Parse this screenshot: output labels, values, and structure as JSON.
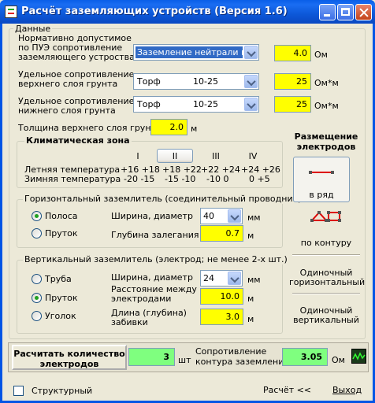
{
  "window": {
    "title": "Расчёт заземляющих устройств (Версия 1.6)"
  },
  "data_group": {
    "title": "Данные",
    "norm_label_1": "Нормативно допустимое",
    "norm_label_2": "по ПУЭ сопротивление",
    "norm_label_3": "заземляющего устроства",
    "norm_select": "Заземление нейтрали гене",
    "norm_value": "4.0",
    "norm_unit": "Ом",
    "upper_label_1": "Удельное сопротивление",
    "upper_label_2": "верхнего слоя грунта",
    "upper_select_name": "Торф",
    "upper_select_range": "10-25",
    "upper_value": "25",
    "upper_unit": "Ом*м",
    "lower_label_1": "Удельное сопротивление",
    "lower_label_2": "нижнего слоя грунта",
    "lower_select_name": "Торф",
    "lower_select_range": "10-25",
    "lower_value": "25",
    "lower_unit": "Ом*м",
    "thickness_label": "Толщина верхнего слоя грунта",
    "thickness_value": "2.0",
    "thickness_unit": "м"
  },
  "climate": {
    "title": "Климатическая зона",
    "zones": [
      "I",
      "II",
      "III",
      "IV"
    ],
    "summer_label": "Летняя температура",
    "winter_label": "Зимняя температура",
    "summer": [
      "+16 +18",
      "+18 +22",
      "+22 +24",
      "+24 +26"
    ],
    "winter": [
      "-20 -15",
      "-15 -10",
      "-10  0",
      "0 +5"
    ]
  },
  "horizontal": {
    "title": "Горизонтальный заземлитель (соединительный проводник)",
    "radio_1": "Полоса",
    "radio_2": "Пруток",
    "width_label": "Ширина, диаметр",
    "width_value": "40",
    "width_unit": "мм",
    "depth_label": "Глубина залегания",
    "depth_value": "0.7",
    "depth_unit": "м"
  },
  "vertical": {
    "title": "Вертикальный заземлитель (электрод; не менее 2-х шт.)",
    "radio_1": "Труба",
    "radio_2": "Пруток",
    "radio_3": "Уголок",
    "width_label": "Ширина, диаметр",
    "width_value": "24",
    "width_unit": "мм",
    "dist_label_1": "Расстояние между",
    "dist_label_2": "электродами",
    "dist_value": "10.0",
    "dist_unit": "м",
    "len_label_1": "Длина (глубина)",
    "len_label_2": "забивки",
    "len_value": "3.0",
    "len_unit": "м"
  },
  "placement": {
    "title_1": "Размещение",
    "title_2": "электродов",
    "row_label": "в ряд",
    "contour_label": "по контуру",
    "single_h_1": "Одиночный",
    "single_h_2": "горизонтальный",
    "single_v_1": "Одиночный",
    "single_v_2": "вертикальный"
  },
  "result": {
    "calc_label_1": "Расчитать количество",
    "calc_label_2": "электродов",
    "count_value": "3",
    "count_unit": "шт",
    "resist_label_1": "Сопротивление",
    "resist_label_2": "контура заземления",
    "resist_value": "3.05",
    "resist_unit": "Ом"
  },
  "footer": {
    "structural_label": "Структурный",
    "calc_link": "Расчёт <<",
    "exit_link": "Выход"
  }
}
